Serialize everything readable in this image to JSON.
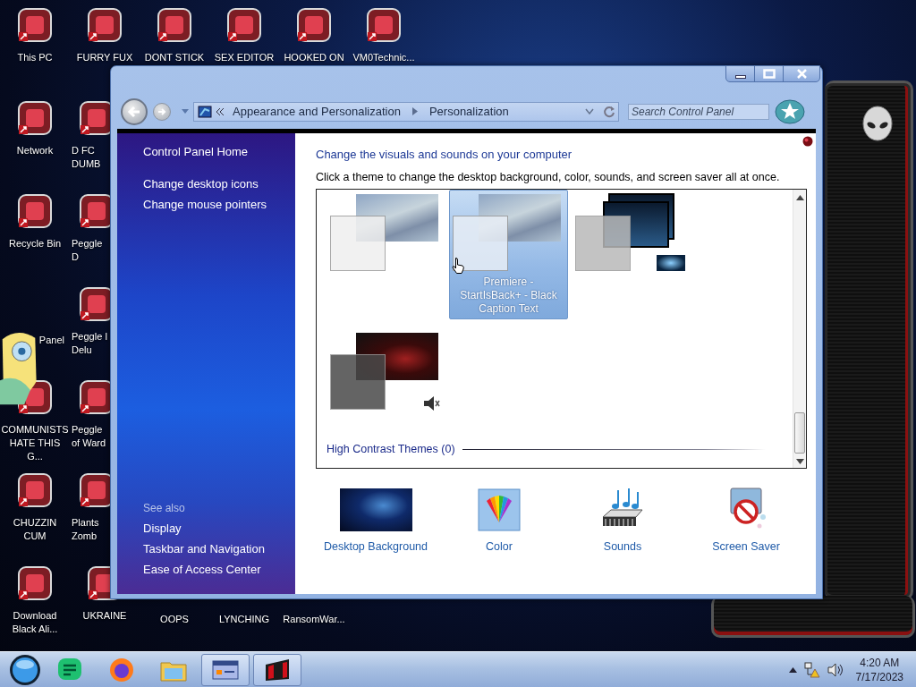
{
  "desktop": {
    "icons": [
      {
        "label": "This PC"
      },
      {
        "label": "FURRY FUX"
      },
      {
        "label": "DONT STICK"
      },
      {
        "label": "SEX EDITOR"
      },
      {
        "label": "HOOKED ON"
      },
      {
        "label": "VM0Technic..."
      },
      {
        "label": "Network"
      },
      {
        "label": "D FC DUMB"
      },
      {
        "label": "Recycle Bin"
      },
      {
        "label": "Peggle D"
      },
      {
        "label": "Panel"
      },
      {
        "label": "Peggle I Delu"
      },
      {
        "label": "COMMUNISTS HATE THIS G..."
      },
      {
        "label": "Peggle of Ward"
      },
      {
        "label": "CHUZZIN CUM"
      },
      {
        "label": "Plants Zomb"
      },
      {
        "label": "Download Black Ali..."
      },
      {
        "label": "UKRAINE"
      },
      {
        "label": "OOPS"
      },
      {
        "label": "LYNCHING"
      },
      {
        "label": "RansomWar..."
      }
    ]
  },
  "window": {
    "nav": {
      "breadcrumb": [
        "Appearance and Personalization",
        "Personalization"
      ],
      "search": {
        "placeholder": "Search Control Panel"
      }
    },
    "sidebar": {
      "links": [
        "Control Panel Home",
        "Change desktop icons",
        "Change mouse pointers"
      ],
      "see_also": {
        "title": "See also",
        "links": [
          "Display",
          "Taskbar and Navigation",
          "Ease of Access Center"
        ]
      }
    },
    "main": {
      "heading": "Change the visuals and sounds on your computer",
      "instructions": "Click a theme to change the desktop background, color, sounds, and screen saver all at once.",
      "themes": [
        {
          "kind": "light",
          "color": "#efefef",
          "selected": false,
          "sound": false
        },
        {
          "kind": "light",
          "color": "#e8eef6",
          "selected": true,
          "sound": false,
          "caption": "Premiere - StartIsBack+ - Black Caption Text"
        },
        {
          "kind": "stack",
          "color": "#b9b9b9",
          "selected": false,
          "sound": false
        },
        {
          "kind": "dark",
          "color": "#4a4a4a",
          "selected": false,
          "sound": true
        }
      ],
      "group": {
        "title": "High Contrast Themes (0)"
      },
      "options": [
        {
          "kind": "background",
          "label": "Desktop Background"
        },
        {
          "kind": "color",
          "label": "Color"
        },
        {
          "kind": "sounds",
          "label": "Sounds"
        },
        {
          "kind": "screensaver",
          "label": "Screen Saver"
        }
      ]
    }
  },
  "taskbar": {
    "items": [
      {
        "kind": "chat",
        "running": false
      },
      {
        "kind": "browser",
        "running": false
      },
      {
        "kind": "folder",
        "running": false
      },
      {
        "kind": "panel",
        "running": true
      },
      {
        "kind": "app",
        "running": true
      }
    ],
    "clock": {
      "time": "4:20 AM",
      "date": "7/17/2023"
    }
  }
}
